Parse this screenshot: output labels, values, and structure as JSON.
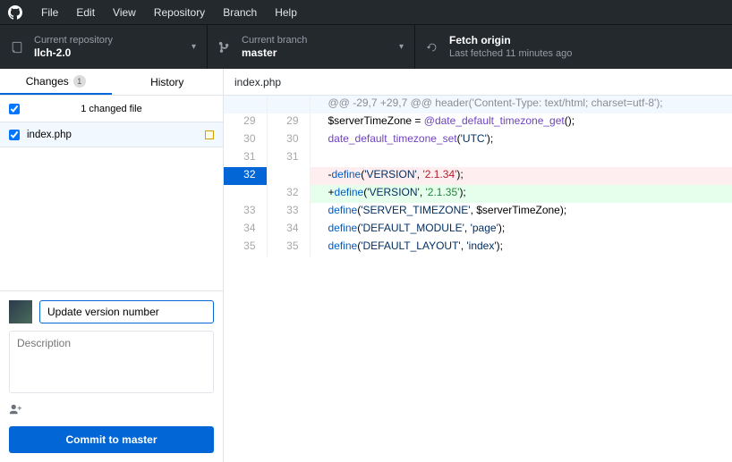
{
  "menu": {
    "items": [
      "File",
      "Edit",
      "View",
      "Repository",
      "Branch",
      "Help"
    ]
  },
  "toolbar": {
    "repo": {
      "hint": "Current repository",
      "value": "Ilch-2.0"
    },
    "branch": {
      "hint": "Current branch",
      "value": "master"
    },
    "fetch": {
      "hint": "Fetch origin",
      "value": "Last fetched 11 minutes ago"
    }
  },
  "sidebar": {
    "tabs": {
      "changes": "Changes",
      "changes_badge": "1",
      "history": "History"
    },
    "files_header": "1 changed file",
    "file": "index.php",
    "commit": {
      "summary_value": "Update version number",
      "desc_placeholder": "Description",
      "button_prefix": "Commit to ",
      "button_branch": "master"
    }
  },
  "diff": {
    "file_tab": "index.php",
    "hunk_header": "@@ -29,7 +29,7 @@ header('Content-Type: text/html; charset=utf-8');",
    "lines": [
      {
        "old": "29",
        "new": "29",
        "type": "ctx",
        "seg": [
          {
            "t": "$serverTimeZone = "
          },
          {
            "t": "@date_default_timezone_get",
            "c": "kw-fn"
          },
          {
            "t": "();"
          }
        ]
      },
      {
        "old": "30",
        "new": "30",
        "type": "ctx",
        "seg": [
          {
            "t": "date_default_timezone_set",
            "c": "kw-fn"
          },
          {
            "t": "("
          },
          {
            "t": "'UTC'",
            "c": "kw-s"
          },
          {
            "t": ");"
          }
        ]
      },
      {
        "old": "31",
        "new": "31",
        "type": "ctx",
        "seg": [
          {
            "t": ""
          }
        ]
      },
      {
        "old": "32",
        "new": "",
        "type": "del",
        "seg": [
          {
            "t": "-"
          },
          {
            "t": "define",
            "c": "kw-const"
          },
          {
            "t": "("
          },
          {
            "t": "'VERSION'",
            "c": "kw-s"
          },
          {
            "t": ", "
          },
          {
            "t": "'2.1.34'",
            "c": "kw-del-s"
          },
          {
            "t": ");"
          }
        ]
      },
      {
        "old": "",
        "new": "32",
        "type": "add",
        "seg": [
          {
            "t": "+"
          },
          {
            "t": "define",
            "c": "kw-const"
          },
          {
            "t": "("
          },
          {
            "t": "'VERSION'",
            "c": "kw-s"
          },
          {
            "t": ", "
          },
          {
            "t": "'2.1.35'",
            "c": "kw-add-s"
          },
          {
            "t": ");"
          }
        ]
      },
      {
        "old": "33",
        "new": "33",
        "type": "ctx",
        "seg": [
          {
            "t": "define",
            "c": "kw-const"
          },
          {
            "t": "("
          },
          {
            "t": "'SERVER_TIMEZONE'",
            "c": "kw-s"
          },
          {
            "t": ", $serverTimeZone);"
          }
        ]
      },
      {
        "old": "34",
        "new": "34",
        "type": "ctx",
        "seg": [
          {
            "t": "define",
            "c": "kw-const"
          },
          {
            "t": "("
          },
          {
            "t": "'DEFAULT_MODULE'",
            "c": "kw-s"
          },
          {
            "t": ", "
          },
          {
            "t": "'page'",
            "c": "kw-s"
          },
          {
            "t": ");"
          }
        ]
      },
      {
        "old": "35",
        "new": "35",
        "type": "ctx",
        "seg": [
          {
            "t": "define",
            "c": "kw-const"
          },
          {
            "t": "("
          },
          {
            "t": "'DEFAULT_LAYOUT'",
            "c": "kw-s"
          },
          {
            "t": ", "
          },
          {
            "t": "'index'",
            "c": "kw-s"
          },
          {
            "t": ");"
          }
        ]
      }
    ]
  }
}
